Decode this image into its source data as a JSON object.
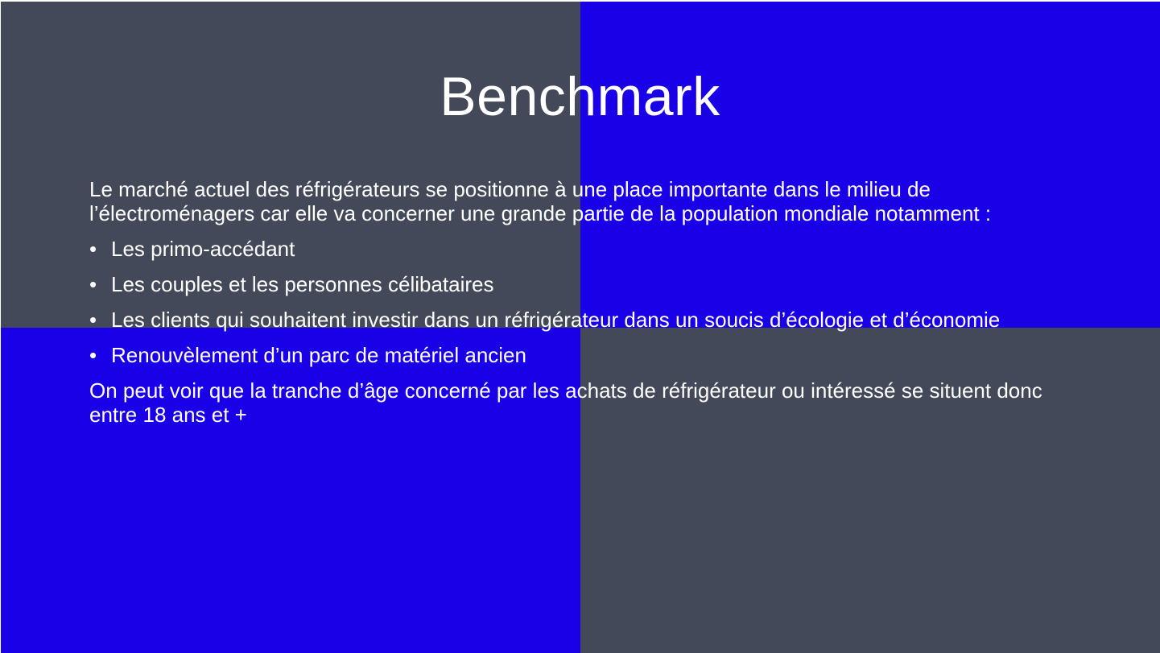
{
  "colors": {
    "slate": "#434959",
    "blue": "#1a00e6",
    "text": "#ffffff"
  },
  "slide": {
    "title": "Benchmark",
    "intro": "Le marché actuel des réfrigérateurs se positionne à une place importante dans le milieu de l’électroménagers car elle va concerner une grande partie de la population mondiale notamment :",
    "bullet_glyph": "•",
    "bullets": [
      "Les primo-accédant",
      "Les couples et les personnes célibataires",
      "Les clients qui souhaitent investir dans un réfrigérateur dans un soucis d’écologie et d’économie",
      "Renouvèlement d’un parc de matériel ancien"
    ],
    "conclusion": "On peut voir que la tranche d’âge concerné par les achats de réfrigérateur ou intéressé se situent donc entre 18 ans et +"
  }
}
